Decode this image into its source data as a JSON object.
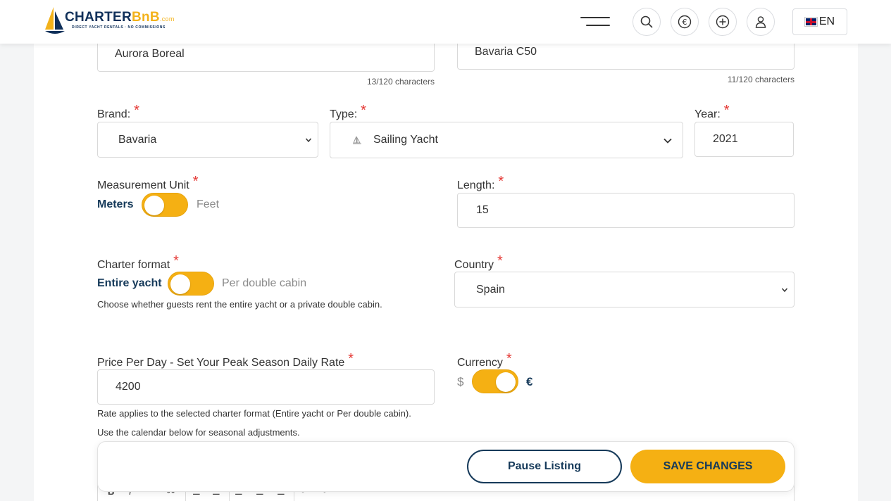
{
  "header": {
    "logo_text": "CHARTER",
    "logo_text_accent": "BnB",
    "logo_suffix": ".com",
    "logo_tagline": "DIRECT YACHT RENTALS · NO COMMISSIONS",
    "language": "EN",
    "icons": [
      "menu-icon",
      "search-icon",
      "euro-icon",
      "plus-circle-icon",
      "user-icon",
      "uk-flag-icon"
    ]
  },
  "form": {
    "name": {
      "value": "Aurora Boreal",
      "counter": "13/120 characters"
    },
    "model": {
      "value": "Bavaria C50",
      "counter": "11/120 characters"
    },
    "brand": {
      "label": "Brand:",
      "value": "Bavaria"
    },
    "type": {
      "label": "Type:",
      "value": "Sailing Yacht"
    },
    "year": {
      "label": "Year:",
      "value": "2021"
    },
    "measurement": {
      "label": "Measurement Unit",
      "option_a": "Meters",
      "option_b": "Feet"
    },
    "length": {
      "label": "Length:",
      "value": "15"
    },
    "charter_format": {
      "label": "Charter format",
      "option_a": "Entire yacht",
      "option_b": "Per double cabin",
      "help": "Choose whether guests rent the entire yacht or a private double cabin."
    },
    "country": {
      "label": "Country",
      "value": "Spain"
    },
    "price": {
      "label": "Price Per Day - Set Your Peak Season Daily Rate",
      "value": "4200",
      "help1": "Rate applies to the selected charter format (Entire yacht or Per double cabin).",
      "help2": "Use the calendar below for seasonal adjustments."
    },
    "currency": {
      "label": "Currency",
      "option_a": "$",
      "option_b": "€"
    },
    "required_mark": "*"
  },
  "actions": {
    "pause_label": "Pause Listing",
    "save_label": "SAVE CHANGES"
  },
  "colors": {
    "accent": "#f5b013",
    "navy": "#163a5a",
    "required": "#e53935"
  }
}
